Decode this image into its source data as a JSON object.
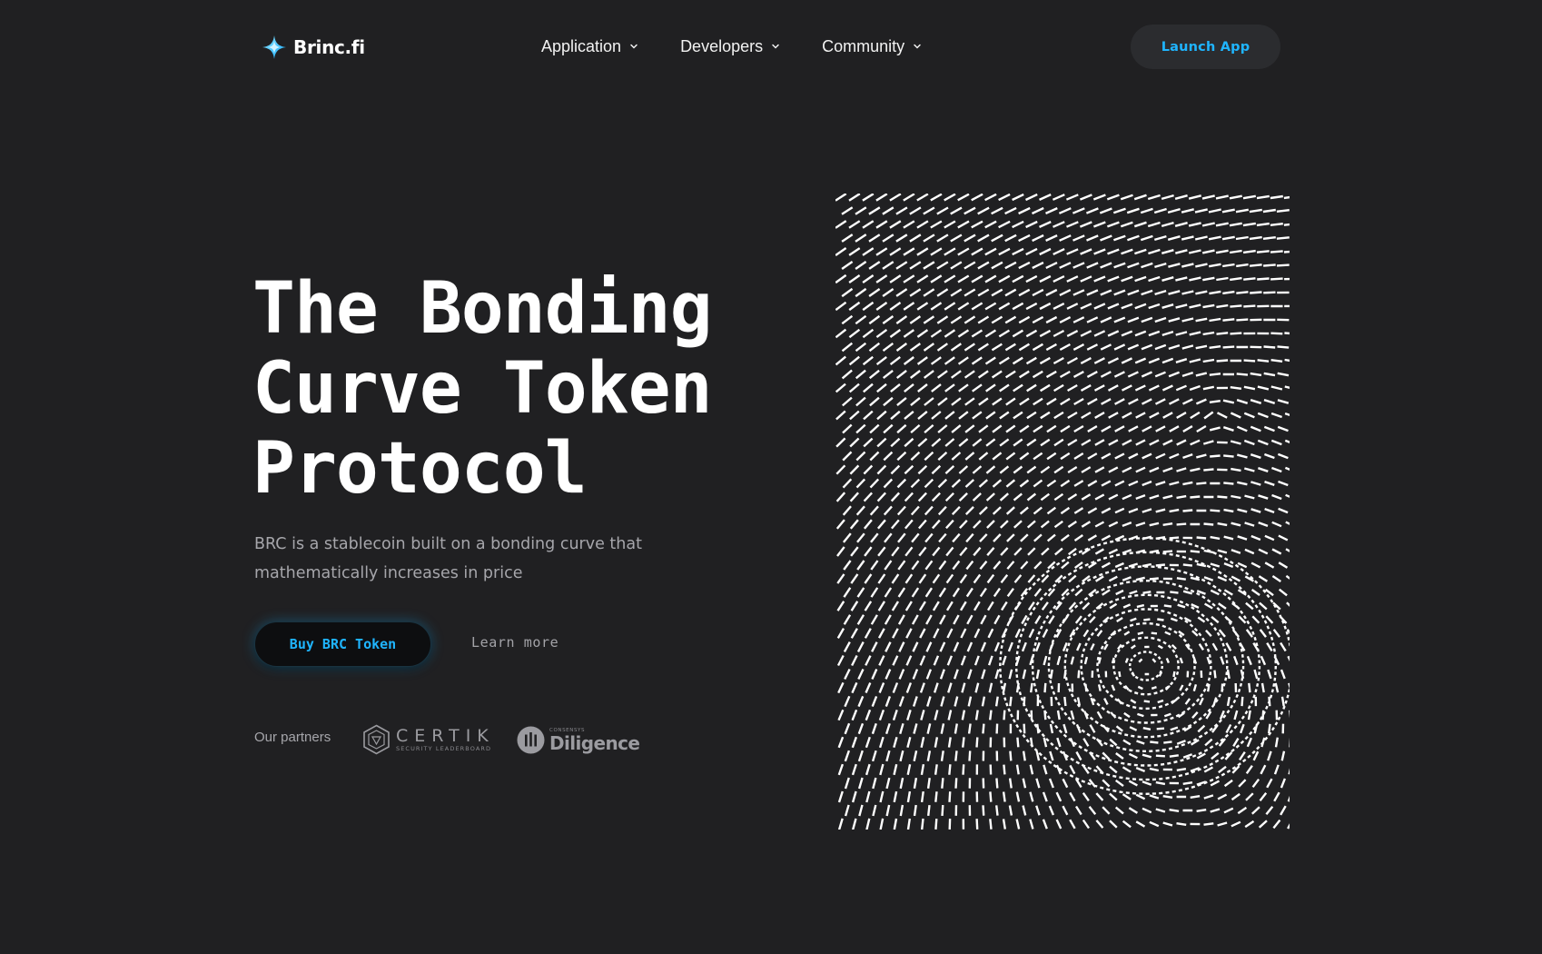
{
  "header": {
    "brand_name": "Brinc.fi",
    "brand_logo_icon": "four-point-star-icon",
    "nav": [
      {
        "label": "Application",
        "icon": "chevron-down-icon"
      },
      {
        "label": "Developers",
        "icon": "chevron-down-icon"
      },
      {
        "label": "Community",
        "icon": "chevron-down-icon"
      }
    ],
    "launch_label": "Launch App"
  },
  "hero": {
    "title_lines": [
      "The Bonding",
      "Curve Token",
      "Protocol"
    ],
    "subtitle_lines": [
      "BRC is a stablecoin built on a bonding curve that",
      "mathematically increases in price"
    ],
    "buy_label": "Buy BRC Token",
    "learn_more_label": "Learn more",
    "artwork": "vortex-dash-pattern"
  },
  "partners": {
    "label": "Our partners",
    "items": [
      {
        "name": "CERTIK",
        "tagline": "SECURITY LEADERBOARD",
        "icon": "certik-shield-icon"
      },
      {
        "name": "Diligence",
        "supertitle": "CONSENSYS",
        "icon": "diligence-circle-icon"
      }
    ]
  },
  "colors": {
    "background": "#202022",
    "accent": "#1fb5ff",
    "text_primary": "#ffffff",
    "text_muted": "#a6a6ab",
    "launch_button_bg": "#2b2c2f",
    "buy_button_bg": "#0d0e10"
  }
}
